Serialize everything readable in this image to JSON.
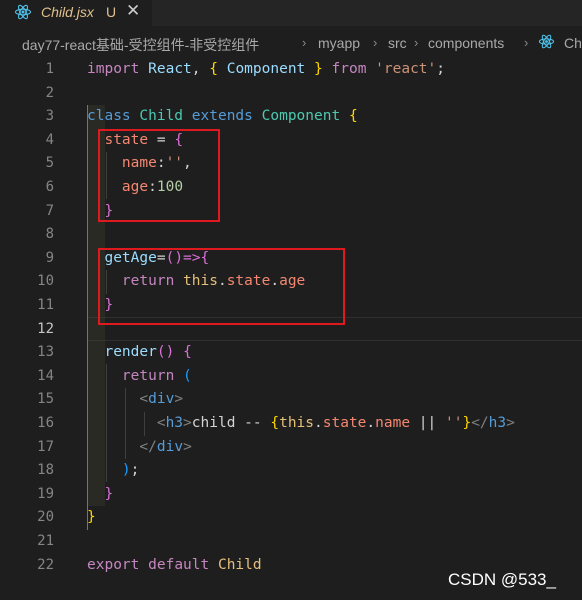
{
  "tab": {
    "icon": "react-icon",
    "filename": "Child.jsx",
    "status": "U",
    "close": "✕"
  },
  "breadcrumb": {
    "items": [
      "day77-react基础-受控组件-非受控组件",
      "myapp",
      "src",
      "components",
      "Ch"
    ],
    "separator": "›"
  },
  "editor": {
    "active_line": "12",
    "line_numbers": [
      "1",
      "2",
      "3",
      "4",
      "5",
      "6",
      "7",
      "8",
      "9",
      "10",
      "11",
      "12",
      "13",
      "14",
      "15",
      "16",
      "17",
      "18",
      "19",
      "20",
      "21",
      "22"
    ]
  },
  "code": {
    "l1": [
      "import",
      "React",
      "Component",
      "from",
      "'react'"
    ],
    "l3": [
      "class",
      "Child",
      "extends",
      "Component"
    ],
    "l4": [
      "state",
      "="
    ],
    "l5": [
      "name",
      "''"
    ],
    "l6": [
      "age",
      "100"
    ],
    "l9": [
      "getAge",
      "()=>"
    ],
    "l10": [
      "return",
      "this",
      "state",
      "age"
    ],
    "l13": [
      "render",
      "()"
    ],
    "l14": [
      "return"
    ],
    "l15": [
      "div"
    ],
    "l16": [
      "h3",
      "child -- ",
      "this",
      "state",
      "name",
      "||",
      "''",
      "h3"
    ],
    "l17": [
      "div"
    ],
    "l22": [
      "export",
      "default",
      "Child"
    ]
  },
  "watermark": "CSDN @533_",
  "colors": {
    "background": "#1e1e1e",
    "keyword": "#c586c0",
    "class": "#4ec9b0",
    "highlight_box": "#e0191e"
  }
}
